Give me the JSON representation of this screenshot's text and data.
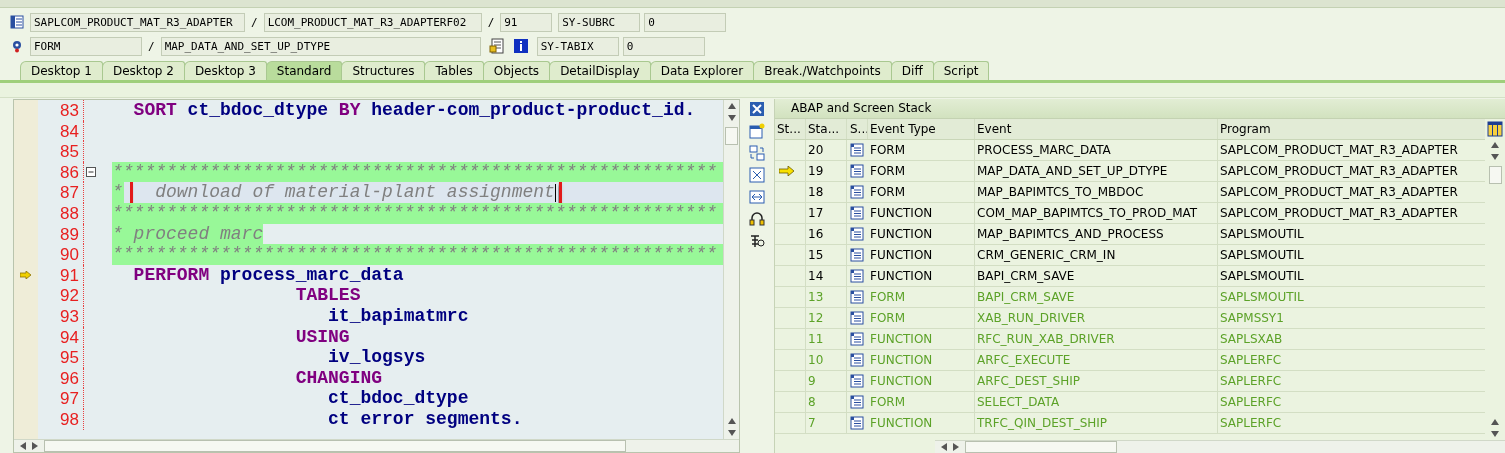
{
  "header": {
    "program": "SAPLCOM_PRODUCT_MAT_R3_ADAPTER",
    "include": "LCOM_PRODUCT_MAT_R3_ADAPTERF02",
    "line": "91",
    "event_type": "FORM",
    "event": "MAP_DATA_AND_SET_UP_DTYPE",
    "separators": [
      "/",
      "/",
      "/"
    ],
    "system_fields": [
      {
        "name": "SY-SUBRC",
        "value": "0"
      },
      {
        "name": "SY-TABIX",
        "value": "0"
      }
    ]
  },
  "tabs": [
    {
      "label": "Desktop 1",
      "selected": false
    },
    {
      "label": "Desktop 2",
      "selected": false
    },
    {
      "label": "Desktop 3",
      "selected": false
    },
    {
      "label": "Standard",
      "selected": true
    },
    {
      "label": "Structures",
      "selected": false
    },
    {
      "label": "Tables",
      "selected": false
    },
    {
      "label": "Objects",
      "selected": false
    },
    {
      "label": "DetailDisplay",
      "selected": false
    },
    {
      "label": "Data Explorer",
      "selected": false
    },
    {
      "label": "Break./Watchpoints",
      "selected": false
    },
    {
      "label": "Diff",
      "selected": false
    },
    {
      "label": "Script",
      "selected": false
    }
  ],
  "editor": {
    "lines": [
      {
        "number": "83",
        "kind": "code",
        "current": false,
        "cursor": false,
        "marked": false,
        "foldable": false,
        "tokens": [
          {
            "kind": "keyword",
            "text": "  SORT"
          },
          {
            "kind": "name",
            "text": "ct_bdoc_dtype"
          },
          {
            "kind": "keyword",
            "text": "BY"
          },
          {
            "kind": "name",
            "text": "header-com_product-product_id."
          }
        ]
      },
      {
        "number": "84",
        "kind": "code",
        "current": false,
        "cursor": false,
        "marked": false,
        "foldable": false
      },
      {
        "number": "85",
        "kind": "code",
        "current": false,
        "cursor": false,
        "marked": false,
        "foldable": false
      },
      {
        "number": "86",
        "kind": "banner",
        "current": false,
        "cursor": false,
        "marked": false,
        "foldable": true,
        "tokens": [
          {
            "kind": "comment",
            "text": "********************************************************"
          }
        ]
      },
      {
        "number": "87",
        "kind": "banner",
        "current": false,
        "cursor": true,
        "marked": true,
        "foldable": false,
        "tokens": [
          {
            "kind": "comment",
            "text": "*"
          },
          {
            "kind": "comment",
            "text": "  download of material-plant assignment"
          }
        ]
      },
      {
        "number": "88",
        "kind": "banner",
        "current": false,
        "cursor": false,
        "marked": false,
        "foldable": false,
        "tokens": [
          {
            "kind": "comment",
            "text": "********************************************************"
          }
        ]
      },
      {
        "number": "89",
        "kind": "comment",
        "current": false,
        "cursor": false,
        "marked": false,
        "foldable": false,
        "tokens": [
          {
            "kind": "comment",
            "text": "* proceed marc"
          }
        ]
      },
      {
        "number": "90",
        "kind": "banner",
        "current": false,
        "cursor": false,
        "marked": false,
        "foldable": false,
        "tokens": [
          {
            "kind": "comment",
            "text": "********************************************************"
          }
        ]
      },
      {
        "number": "91",
        "kind": "code",
        "current": true,
        "cursor": false,
        "marked": false,
        "foldable": false,
        "tokens": [
          {
            "kind": "keyword",
            "text": "  PERFORM"
          },
          {
            "kind": "name",
            "text": "process_marc_data"
          }
        ]
      },
      {
        "number": "92",
        "kind": "code",
        "current": false,
        "cursor": false,
        "marked": false,
        "foldable": false,
        "tokens": [
          {
            "kind": "keyword",
            "text": "                 TABLES"
          }
        ]
      },
      {
        "number": "93",
        "kind": "code",
        "current": false,
        "cursor": false,
        "marked": false,
        "foldable": false,
        "tokens": [
          {
            "kind": "name",
            "text": "                    it_bapimatmrc"
          }
        ]
      },
      {
        "number": "94",
        "kind": "code",
        "current": false,
        "cursor": false,
        "marked": false,
        "foldable": false,
        "tokens": [
          {
            "kind": "keyword",
            "text": "                 USING"
          }
        ]
      },
      {
        "number": "95",
        "kind": "code",
        "current": false,
        "cursor": false,
        "marked": false,
        "foldable": false,
        "tokens": [
          {
            "kind": "name",
            "text": "                    iv_logsys"
          }
        ]
      },
      {
        "number": "96",
        "kind": "code",
        "current": false,
        "cursor": false,
        "marked": false,
        "foldable": false,
        "tokens": [
          {
            "kind": "keyword",
            "text": "                 CHANGING"
          }
        ]
      },
      {
        "number": "97",
        "kind": "code",
        "current": false,
        "cursor": false,
        "marked": false,
        "foldable": false,
        "tokens": [
          {
            "kind": "name",
            "text": "                    ct_bdoc_dtype"
          }
        ]
      },
      {
        "number": "98",
        "kind": "code",
        "current": false,
        "cursor": false,
        "marked": false,
        "foldable": false,
        "tokens": [
          {
            "kind": "name",
            "text": "                    ct error segments."
          }
        ]
      }
    ]
  },
  "stack": {
    "title": "ABAP and Screen Stack",
    "columns": [
      "St...",
      "Sta...",
      "S...",
      "Event Type",
      "Event",
      "Program"
    ],
    "rows": [
      {
        "stack_level": "20",
        "event_type": "FORM",
        "event": "PROCESS_MARC_DATA",
        "program": "SAPLCOM_PRODUCT_MAT_R3_ADAPTER",
        "current": false,
        "dimmed": false
      },
      {
        "stack_level": "19",
        "event_type": "FORM",
        "event": "MAP_DATA_AND_SET_UP_DTYPE",
        "program": "SAPLCOM_PRODUCT_MAT_R3_ADAPTER",
        "current": true,
        "dimmed": false
      },
      {
        "stack_level": "18",
        "event_type": "FORM",
        "event": "MAP_BAPIMTCS_TO_MBDOC",
        "program": "SAPLCOM_PRODUCT_MAT_R3_ADAPTER",
        "current": false,
        "dimmed": false
      },
      {
        "stack_level": "17",
        "event_type": "FUNCTION",
        "event": "COM_MAP_BAPIMTCS_TO_PROD_MAT",
        "program": "SAPLCOM_PRODUCT_MAT_R3_ADAPTER",
        "current": false,
        "dimmed": false
      },
      {
        "stack_level": "16",
        "event_type": "FUNCTION",
        "event": "MAP_BAPIMTCS_AND_PROCESS",
        "program": "SAPLSMOUTIL",
        "current": false,
        "dimmed": false
      },
      {
        "stack_level": "15",
        "event_type": "FUNCTION",
        "event": "CRM_GENERIC_CRM_IN",
        "program": "SAPLSMOUTIL",
        "current": false,
        "dimmed": false
      },
      {
        "stack_level": "14",
        "event_type": "FUNCTION",
        "event": "BAPI_CRM_SAVE",
        "program": "SAPLSMOUTIL",
        "current": false,
        "dimmed": false
      },
      {
        "stack_level": "13",
        "event_type": "FORM",
        "event": "BAPI_CRM_SAVE",
        "program": "SAPLSMOUTIL",
        "current": false,
        "dimmed": true
      },
      {
        "stack_level": "12",
        "event_type": "FORM",
        "event": "XAB_RUN_DRIVER",
        "program": "SAPMSSY1",
        "current": false,
        "dimmed": true
      },
      {
        "stack_level": "11",
        "event_type": "FUNCTION",
        "event": "RFC_RUN_XAB_DRIVER",
        "program": "SAPLSXAB",
        "current": false,
        "dimmed": true
      },
      {
        "stack_level": "10",
        "event_type": "FUNCTION",
        "event": "ARFC_EXECUTE",
        "program": "SAPLERFC",
        "current": false,
        "dimmed": true
      },
      {
        "stack_level": "9",
        "event_type": "FUNCTION",
        "event": "ARFC_DEST_SHIP",
        "program": "SAPLERFC",
        "current": false,
        "dimmed": true
      },
      {
        "stack_level": "8",
        "event_type": "FORM",
        "event": "SELECT_DATA",
        "program": "SAPLERFC",
        "current": false,
        "dimmed": true
      },
      {
        "stack_level": "7",
        "event_type": "FUNCTION",
        "event": "TRFC_QIN_DEST_SHIP",
        "program": "SAPLERFC",
        "current": false,
        "dimmed": true
      }
    ]
  }
}
